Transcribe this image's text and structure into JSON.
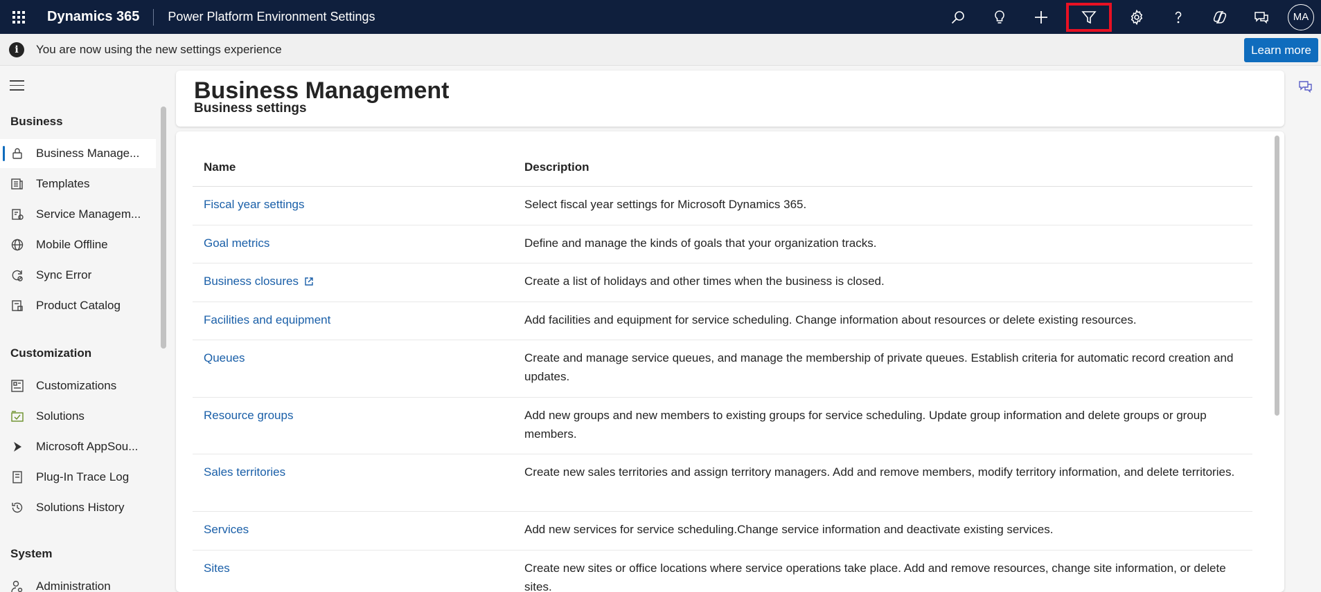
{
  "topbar": {
    "brand": "Dynamics 365",
    "app_title": "Power Platform Environment Settings",
    "icons": [
      "search-icon",
      "lightbulb-icon",
      "plus-icon",
      "filter-icon",
      "gear-icon",
      "help-icon",
      "copilot-icon",
      "chat-icon"
    ],
    "avatar_initials": "MA"
  },
  "notice": {
    "text": "You are now using the new settings experience",
    "learn_more": "Learn more"
  },
  "sidebar": {
    "sections": [
      {
        "title": "Business",
        "items": [
          {
            "label": "Business Manage...",
            "icon": "business-icon",
            "active": true
          },
          {
            "label": "Templates",
            "icon": "templates-icon"
          },
          {
            "label": "Service Managem...",
            "icon": "service-icon"
          },
          {
            "label": "Mobile Offline",
            "icon": "globe-icon"
          },
          {
            "label": "Sync Error",
            "icon": "sync-error-icon"
          },
          {
            "label": "Product Catalog",
            "icon": "catalog-icon"
          }
        ]
      },
      {
        "title": "Customization",
        "items": [
          {
            "label": "Customizations",
            "icon": "customizations-icon"
          },
          {
            "label": "Solutions",
            "icon": "solutions-icon"
          },
          {
            "label": "Microsoft AppSou...",
            "icon": "appsource-icon"
          },
          {
            "label": "Plug-In Trace Log",
            "icon": "trace-log-icon"
          },
          {
            "label": "Solutions History",
            "icon": "history-icon"
          }
        ]
      },
      {
        "title": "System",
        "items": [
          {
            "label": "Administration",
            "icon": "admin-icon"
          }
        ]
      }
    ]
  },
  "header": {
    "title": "Business Management",
    "subtitle": "Business settings"
  },
  "table": {
    "columns": [
      "Name",
      "Description"
    ],
    "rows": [
      {
        "name": "Fiscal year settings",
        "description": "Select fiscal year settings for Microsoft Dynamics 365."
      },
      {
        "name": "Goal metrics",
        "description": "Define and manage the kinds of goals that your organization tracks."
      },
      {
        "name": "Business closures",
        "description": "Create a list of holidays and other times when the business is closed.",
        "external": true
      },
      {
        "name": "Facilities and equipment",
        "description": "Add facilities and equipment for service scheduling. Change information about resources or delete existing resources."
      },
      {
        "name": "Queues",
        "description": "Create and manage service queues, and manage the membership of private queues. Establish criteria for automatic record creation and updates."
      },
      {
        "name": "Resource groups",
        "description": "Add new groups and new members to existing groups for service scheduling. Update group information and delete groups or group members."
      },
      {
        "name": "Sales territories",
        "description": "Create new sales territories and assign territory managers. Add and remove members, modify territory information, and delete territories."
      },
      {
        "name": "Services",
        "description": "Add new services for service scheduling.Change service information and deactivate existing services."
      },
      {
        "name": "Sites",
        "description": "Create new sites or office locations where service operations take place. Add and remove resources, change site information, or delete sites."
      }
    ]
  }
}
